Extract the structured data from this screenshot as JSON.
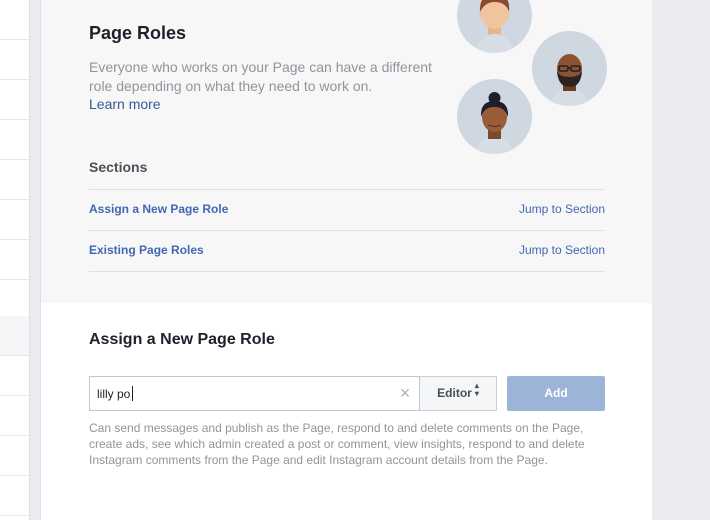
{
  "hero": {
    "title": "Page Roles",
    "description": "Everyone who works on your Page can have a different role depending on what they need to work on.",
    "learn_more": "Learn more",
    "avatars": [
      "man-avatar-icon",
      "bearded-man-avatar-icon",
      "woman-avatar-icon"
    ]
  },
  "sections": {
    "heading": "Sections",
    "items": [
      {
        "label": "Assign a New Page Role",
        "jump": "Jump to Section"
      },
      {
        "label": "Existing Page Roles",
        "jump": "Jump to Section"
      }
    ]
  },
  "assign": {
    "title": "Assign a New Page Role",
    "input_value": "lilly po",
    "clear_icon": "close-icon",
    "role_selected": "Editor",
    "add_label": "Add",
    "role_description": "Can send messages and publish as the Page, respond to and delete comments on the Page, create ads, see which admin created a post or comment, view insights, respond to and delete Instagram comments from the Page and edit Instagram account details from the Page."
  },
  "colors": {
    "link": "#4267b2",
    "add_button_disabled": "#9cb4d8",
    "hero_background": "#f7f7f8",
    "page_background": "#e9ebee"
  }
}
